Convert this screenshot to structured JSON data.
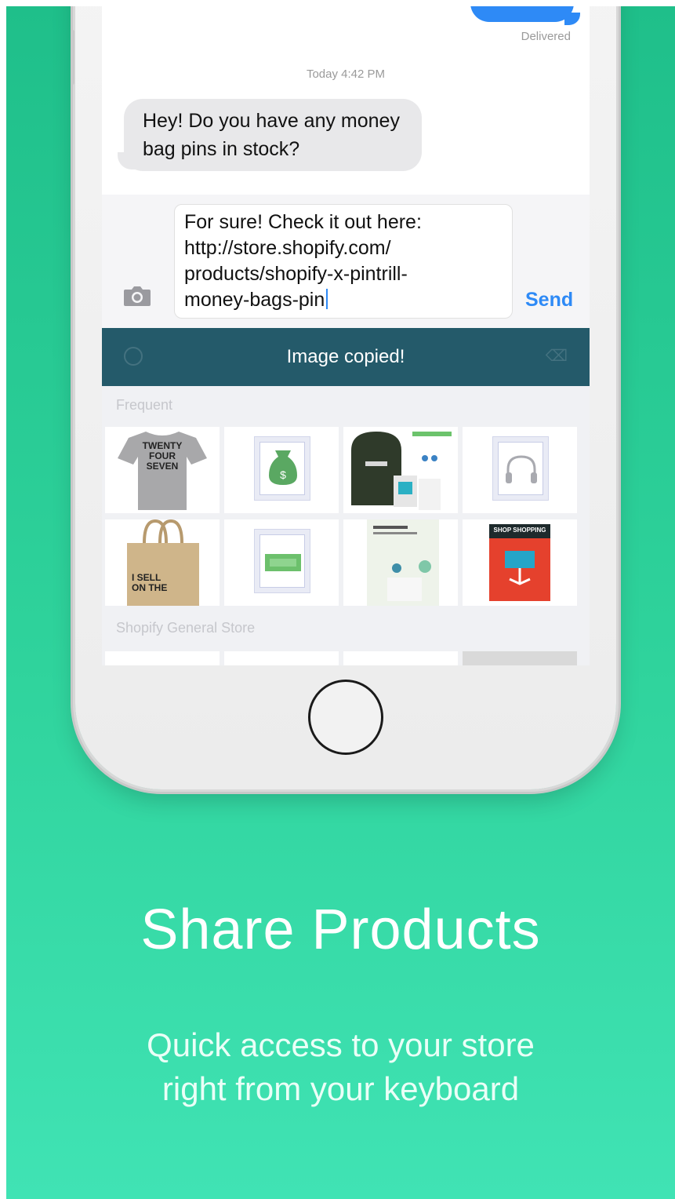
{
  "messages": {
    "delivered": "Delivered",
    "timestamp": "Today 4:42 PM",
    "incoming": "Hey! Do you have any money bag pins in stock?"
  },
  "compose": {
    "text_lines": [
      "For sure! Check it out here:",
      "http://store.shopify.com/",
      "products/shopify-x-pintrill-",
      "money-bags-pin"
    ],
    "send_label": "Send"
  },
  "banner": {
    "label": "Image copied!"
  },
  "keyboard": {
    "section_frequent": "Frequent",
    "section_store": "Shopify General Store",
    "tshirt_text": [
      "TWENTY",
      "FOUR",
      "SEVEN"
    ],
    "tote_text": [
      "I SELL",
      "ON THE"
    ],
    "book_title": "SHOP SHOPPING"
  },
  "colors": {
    "accent_blue": "#2e8af6",
    "banner": "#245a6a",
    "background_top": "#1fbf8a",
    "background_bottom": "#40e3b4"
  },
  "headline": "Share Products",
  "subline_lines": [
    "Quick access to your store",
    "right from your keyboard"
  ]
}
